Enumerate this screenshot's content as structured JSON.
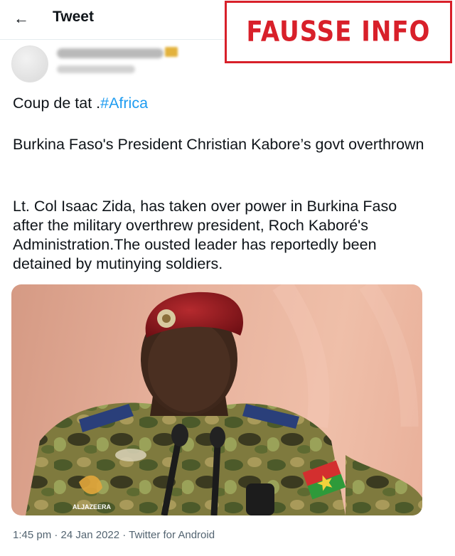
{
  "header": {
    "back_icon": "arrow-left-icon",
    "title": "Tweet"
  },
  "stamp": {
    "text": "FAUSSE INFO",
    "color": "#d8202a"
  },
  "tweet": {
    "line1_text": "Coup de tat .",
    "hashtag": "#Africa",
    "paragraph2": "Burkina Faso's President Christian Kabore’s govt overthrown",
    "paragraph3": "Lt. Col  Isaac Zida, has taken over power in Burkina Faso after the military overthrew president, Roch Kaboré's Administration.The ousted leader has reportedly been detained by mutinying soldiers.",
    "timestamp": "1:45 pm · 24 Jan 2022 · Twitter for Android"
  },
  "media": {
    "watermark": "ALJAZEERA",
    "hashtag_color": "#1d9bf0"
  }
}
